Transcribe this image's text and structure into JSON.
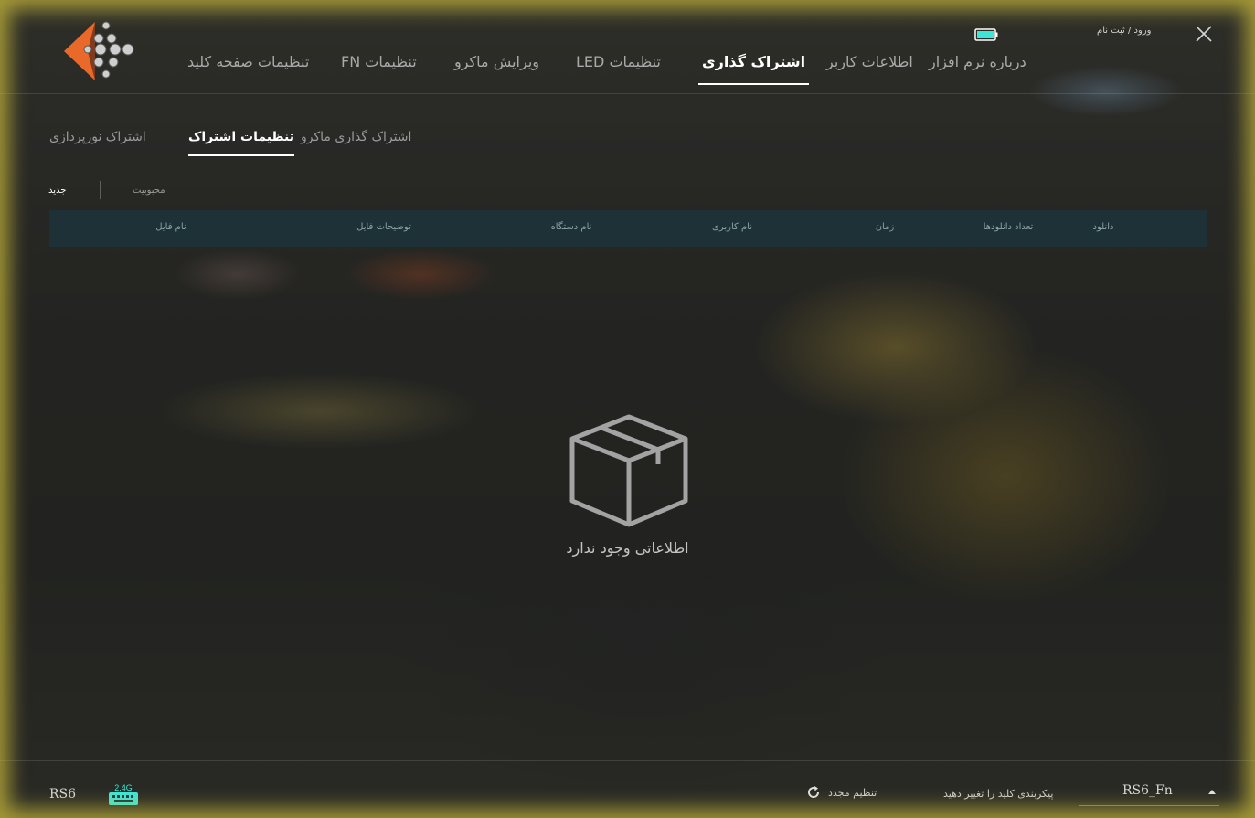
{
  "header": {
    "tabs": [
      {
        "id": "about",
        "label": "درباره نرم افزار"
      },
      {
        "id": "user-info",
        "label": "اطلاعات کاربر"
      },
      {
        "id": "sharing",
        "label": "اشتراک گذاری"
      },
      {
        "id": "led",
        "label": "LED تنظیمات"
      },
      {
        "id": "macro",
        "label": "ویرایش ماکرو"
      },
      {
        "id": "fn",
        "label": "FN تنظیمات"
      },
      {
        "id": "keyboard",
        "label": "تنظیمات صفحه کلید"
      }
    ],
    "active_tab": "sharing",
    "login_label": "ورود / ثبت نام"
  },
  "subtabs": [
    {
      "id": "macro-share",
      "label": "اشتراک گذاری ماکرو"
    },
    {
      "id": "settings-share",
      "label": "تنظیمات اشتراک"
    },
    {
      "id": "lighting-share",
      "label": "اشتراک نورپردازی"
    }
  ],
  "active_subtab": "settings-share",
  "filters": {
    "new_label": "جدید",
    "popular_label": "محبوبیت"
  },
  "table": {
    "columns": [
      {
        "id": "download",
        "label": "دانلود"
      },
      {
        "id": "download-count",
        "label": "تعداد دانلودها"
      },
      {
        "id": "time",
        "label": "زمان"
      },
      {
        "id": "username",
        "label": "نام کاربری"
      },
      {
        "id": "device-name",
        "label": "نام دستگاه"
      },
      {
        "id": "file-description",
        "label": "توضیحات فایل"
      },
      {
        "id": "file-name",
        "label": "نام فایل"
      }
    ],
    "rows": []
  },
  "empty_state": {
    "message": "اطلاعاتی وجود ندارد",
    "icon": "box-icon"
  },
  "footer": {
    "device_name": "RS6",
    "dongle_label": "2.4G",
    "reset_label": "تنظیم مجدد",
    "remap_label": "پیکربندی کلید را تغییر دهید",
    "profile_value": "RS6_Fn"
  },
  "colors": {
    "battery": "#3ee6d8",
    "dongle": "#3ee6d8",
    "logo_orange": "#e8692a",
    "table_header": "#1c343a",
    "frame_glow": "#cdbe3c"
  },
  "icons": {
    "close": "close-icon",
    "battery": "battery-icon",
    "reset": "refresh-icon",
    "caret": "caret-up-icon",
    "dongle": "wireless-dongle-icon",
    "logo": "logo-icon"
  }
}
